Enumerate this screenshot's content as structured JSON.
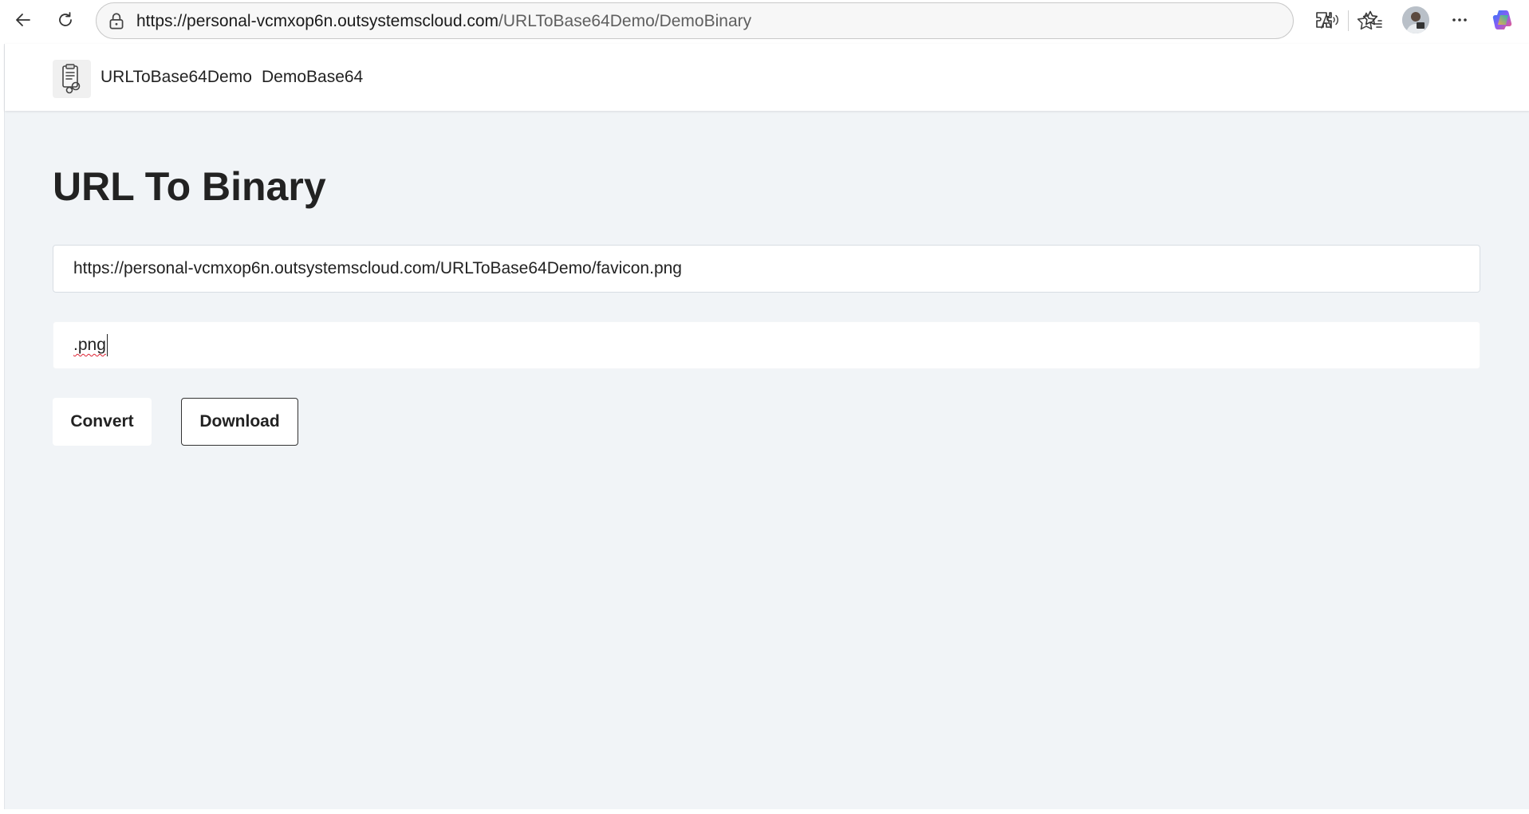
{
  "browser": {
    "url_host": "https://personal-vcmxop6n.outsystemscloud.com",
    "url_path": "/URLToBase64Demo/DemoBinary"
  },
  "app": {
    "name": "URLToBase64Demo",
    "menu": [
      {
        "label": "DemoBase64"
      }
    ]
  },
  "page": {
    "title": "URL To Binary",
    "url_input_value": "https://personal-vcmxop6n.outsystemscloud.com/URLToBase64Demo/favicon.png",
    "extension_input_value": ".png",
    "convert_label": "Convert",
    "download_label": "Download"
  },
  "colors": {
    "page_background": "#f1f4f7",
    "header_background": "#ffffff",
    "text": "#222222"
  },
  "icons": [
    "back-icon",
    "refresh-icon",
    "lock-icon",
    "read-aloud-icon",
    "favorite-star-icon",
    "extensions-icon",
    "favorites-icon",
    "profile-avatar",
    "more-options-icon",
    "copilot-icon",
    "app-logo-icon"
  ]
}
